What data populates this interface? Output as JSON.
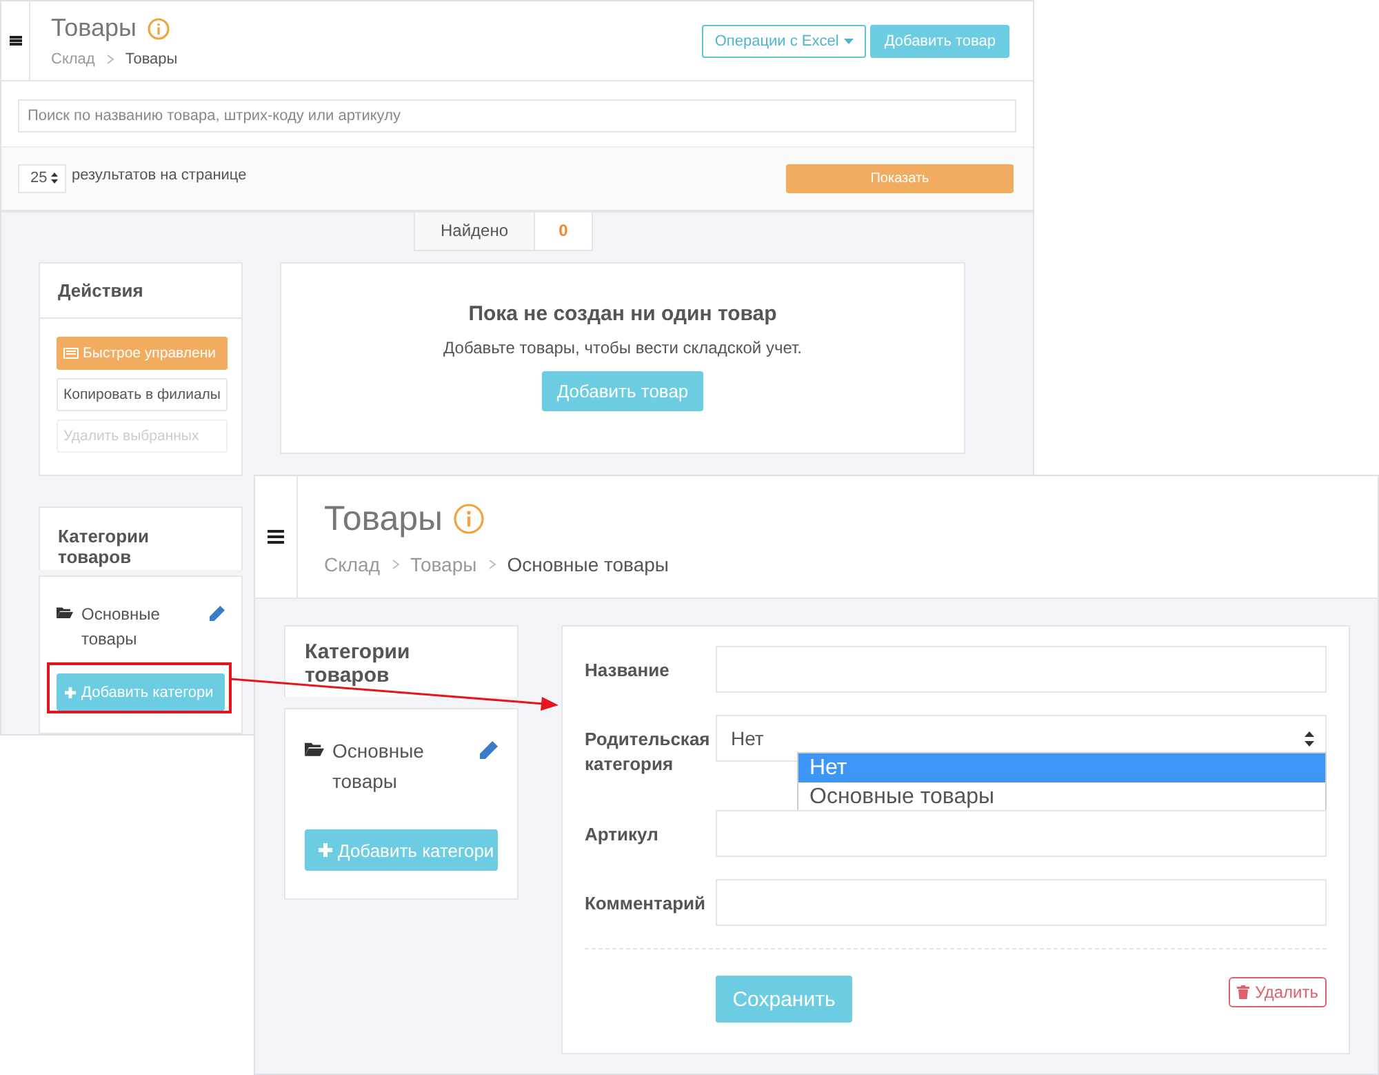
{
  "back_window": {
    "header": {
      "title": "Товары",
      "breadcrumb": [
        {
          "label": "Склад",
          "current": false
        },
        {
          "label": "Товары",
          "current": true
        }
      ],
      "buttons": [
        {
          "label": "Операции с Excel",
          "kind": "outline"
        },
        {
          "label": "Добавить товар",
          "kind": "info"
        }
      ]
    },
    "search": {
      "placeholder": "Поиск по названию товара, штрих-коду или артикулу"
    },
    "per_page": {
      "value": "25",
      "label": "результатов на странице"
    },
    "show_button": "Показать",
    "found": {
      "label": "Найдено",
      "count": "0"
    },
    "actions": {
      "title": "Действия",
      "buttons": [
        {
          "label": "Быстрое управлени",
          "kind": "warning",
          "disabled": false
        },
        {
          "label": "Копировать в филиалы",
          "kind": "default",
          "disabled": false
        },
        {
          "label": "Удалить выбранных",
          "kind": "default",
          "disabled": true
        }
      ]
    },
    "empty_state": {
      "title": "Пока не создан ни один товар",
      "text": "Добавьте товары, чтобы вести складской учет.",
      "button": "Добавить товар"
    },
    "categories": {
      "title": "Категории товаров",
      "items": [
        {
          "label": "Основные товары"
        }
      ],
      "add_button": "Добавить категори"
    }
  },
  "front_window": {
    "header": {
      "title": "Товары",
      "breadcrumb": [
        {
          "label": "Склад",
          "current": false
        },
        {
          "label": "Товары",
          "current": false
        },
        {
          "label": "Основные товары",
          "current": true
        }
      ]
    },
    "categories": {
      "title": "Категории товаров",
      "items": [
        {
          "label": "Основные товары"
        }
      ],
      "add_button": "Добавить категори"
    },
    "form": {
      "fields": [
        {
          "label": "Название",
          "kind": "text"
        },
        {
          "label": "Родительская категория",
          "kind": "select",
          "value": "Нет",
          "options": [
            {
              "label": "Нет",
              "selected": true
            },
            {
              "label": "Основные товары",
              "selected": false
            }
          ]
        },
        {
          "label": "Артикул",
          "kind": "text"
        },
        {
          "label": "Комментарий",
          "kind": "text"
        }
      ],
      "save_button": "Сохранить",
      "delete_button": "Удалить"
    }
  }
}
